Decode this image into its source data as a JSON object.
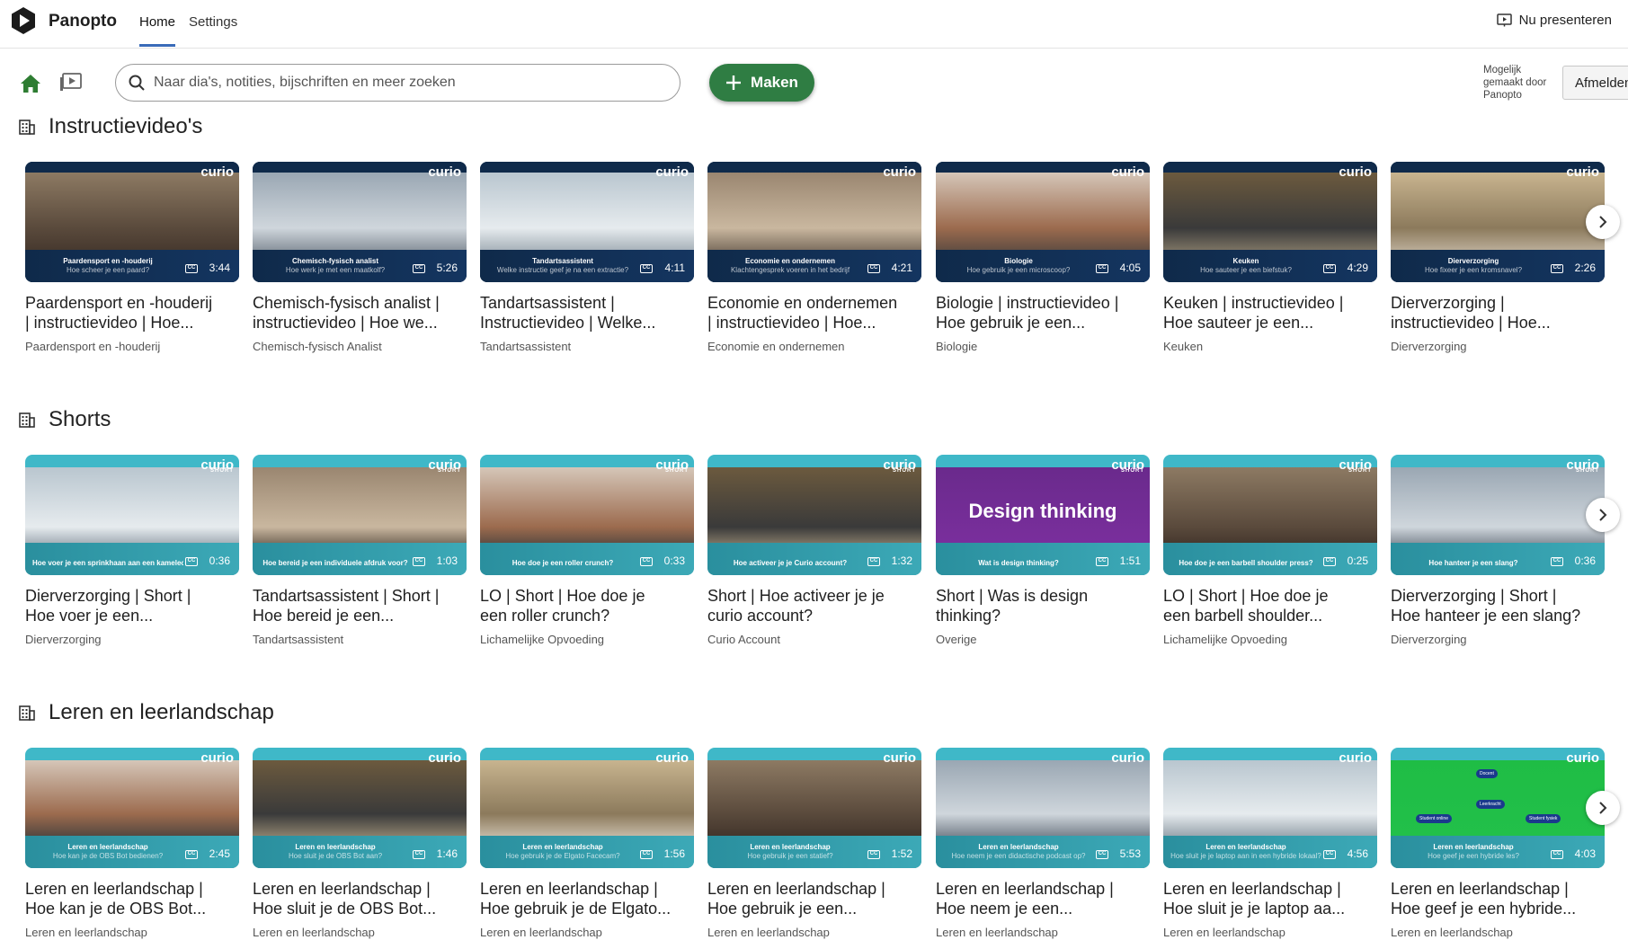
{
  "app": {
    "brand": "Panopto"
  },
  "nav": {
    "tabs": [
      "Home",
      "Settings"
    ],
    "active": "Home",
    "present_label": "Nu presenteren"
  },
  "toolbar": {
    "search_placeholder": "Naar dia's, notities, bijschriften en meer zoeken",
    "make_label": "Maken",
    "powered_by": [
      "Mogelijk",
      "gemaakt door",
      "Panopto"
    ],
    "signout_label": "Afmelden"
  },
  "colors": {
    "accent_green": "#2f7d43",
    "tab_underline": "#3a6bb8",
    "curio_teal": "#3fb8c8",
    "curio_navy": "#0f2a4a"
  },
  "sections": [
    {
      "title": "Instructievideo's",
      "style": "instruct",
      "cards": [
        {
          "title": [
            "Paardensport en -houderij",
            "| instructievideo | Hoe..."
          ],
          "folder": "Paardensport en -houderij",
          "duration": "3:44",
          "overlay": [
            "Paardensport en -houderij",
            "Hoe scheer je een paard?"
          ]
        },
        {
          "title": [
            "Chemisch-fysisch analist |",
            "instructievideo | Hoe we..."
          ],
          "folder": "Chemisch-fysisch Analist",
          "duration": "5:26",
          "overlay": [
            "Chemisch-fysisch analist",
            "Hoe werk je met een maatkolf?"
          ]
        },
        {
          "title": [
            "Tandartsassistent |",
            "Instructievideo | Welke..."
          ],
          "folder": "Tandartsassistent",
          "duration": "4:11",
          "overlay": [
            "Tandartsassistent",
            "Welke instructie geef je na een extractie?"
          ]
        },
        {
          "title": [
            "Economie en ondernemen",
            "| instructievideo | Hoe..."
          ],
          "folder": "Economie en ondernemen",
          "duration": "4:21",
          "overlay": [
            "Economie en ondernemen",
            "Klachtengesprek voeren in het bedrijf"
          ]
        },
        {
          "title": [
            "Biologie | instructievideo |",
            "Hoe gebruik je een..."
          ],
          "folder": "Biologie",
          "duration": "4:05",
          "overlay": [
            "Biologie",
            "Hoe gebruik je een microscoop?"
          ]
        },
        {
          "title": [
            "Keuken | instructievideo |",
            "Hoe sauteer je een..."
          ],
          "folder": "Keuken",
          "duration": "4:29",
          "overlay": [
            "Keuken",
            "Hoe sauteer je een biefstuk?"
          ]
        },
        {
          "title": [
            "Dierverzorging |",
            "instructievideo | Hoe..."
          ],
          "folder": "Dierverzorging",
          "duration": "2:26",
          "overlay": [
            "Dierverzorging",
            "Hoe fixeer je een kromsnavel?"
          ]
        }
      ]
    },
    {
      "title": "Shorts",
      "style": "short",
      "cards": [
        {
          "title": [
            "Dierverzorging | Short |",
            "Hoe voer je een..."
          ],
          "folder": "Dierverzorging",
          "duration": "0:36",
          "overlay": [
            "Hoe voer je een sprinkhaan aan een kameleon?"
          ]
        },
        {
          "title": [
            "Tandartsassistent | Short |",
            "Hoe bereid je een..."
          ],
          "folder": "Tandartsassistent",
          "duration": "1:03",
          "overlay": [
            "Hoe bereid je een individuele afdruk voor?"
          ]
        },
        {
          "title": [
            "LO | Short | Hoe doe je",
            "een roller crunch?"
          ],
          "folder": "Lichamelijke Opvoeding",
          "duration": "0:33",
          "overlay": [
            "Hoe doe je een roller crunch?"
          ]
        },
        {
          "title": [
            "Short | Hoe activeer je je",
            "curio account?"
          ],
          "folder": "Curio Account",
          "duration": "1:32",
          "overlay": [
            "Hoe activeer je je Curio account?"
          ]
        },
        {
          "title": [
            "Short | Was is design",
            "thinking?"
          ],
          "folder": "Overige",
          "duration": "1:51",
          "overlay": [
            "Wat is design thinking?"
          ],
          "banner": "Design thinking"
        },
        {
          "title": [
            "LO | Short | Hoe doe je",
            "een barbell shoulder..."
          ],
          "folder": "Lichamelijke Opvoeding",
          "duration": "0:25",
          "overlay": [
            "Hoe doe je een barbell shoulder press?"
          ]
        },
        {
          "title": [
            "Dierverzorging | Short |",
            "Hoe hanteer je een slang?"
          ],
          "folder": "Dierverzorging",
          "duration": "0:36",
          "overlay": [
            "Hoe hanteer je een slang?"
          ]
        }
      ]
    },
    {
      "title": "Leren en leerlandschap",
      "style": "leren",
      "cards": [
        {
          "title": [
            "Leren en leerlandschap |",
            "Hoe kan je de OBS Bot..."
          ],
          "folder": "Leren en leerlandschap",
          "duration": "2:45",
          "overlay": [
            "Leren en leerlandschap",
            "Hoe kan je de OBS Bot bedienen?"
          ]
        },
        {
          "title": [
            "Leren en leerlandschap |",
            "Hoe sluit je de OBS Bot..."
          ],
          "folder": "Leren en leerlandschap",
          "duration": "1:46",
          "overlay": [
            "Leren en leerlandschap",
            "Hoe sluit je de OBS Bot aan?"
          ]
        },
        {
          "title": [
            "Leren en leerlandschap |",
            "Hoe gebruik je de Elgato..."
          ],
          "folder": "Leren en leerlandschap",
          "duration": "1:56",
          "overlay": [
            "Leren en leerlandschap",
            "Hoe gebruik je de Elgato Facecam?"
          ]
        },
        {
          "title": [
            "Leren en leerlandschap |",
            "Hoe gebruik je een..."
          ],
          "folder": "Leren en leerlandschap",
          "duration": "1:52",
          "overlay": [
            "Leren en leerlandschap",
            "Hoe gebruik je een statief?"
          ]
        },
        {
          "title": [
            "Leren en leerlandschap |",
            "Hoe neem je een..."
          ],
          "folder": "Leren en leerlandschap",
          "duration": "5:53",
          "overlay": [
            "Leren en leerlandschap",
            "Hoe neem je een didactische podcast op?"
          ]
        },
        {
          "title": [
            "Leren en leerlandschap |",
            "Hoe sluit je je laptop aa..."
          ],
          "folder": "Leren en leerlandschap",
          "duration": "4:56",
          "overlay": [
            "Leren en leerlandschap",
            "Hoe sluit je je laptop aan in een hybride lokaal?"
          ]
        },
        {
          "title": [
            "Leren en leerlandschap |",
            "Hoe geef je een hybride..."
          ],
          "folder": "Leren en leerlandschap",
          "duration": "4:03",
          "overlay": [
            "Leren en leerlandschap",
            "Hoe geef je een hybride les?"
          ],
          "diagram": [
            "Docent",
            "Leerkracht",
            "Student online",
            "Student fysiek"
          ]
        }
      ]
    }
  ]
}
